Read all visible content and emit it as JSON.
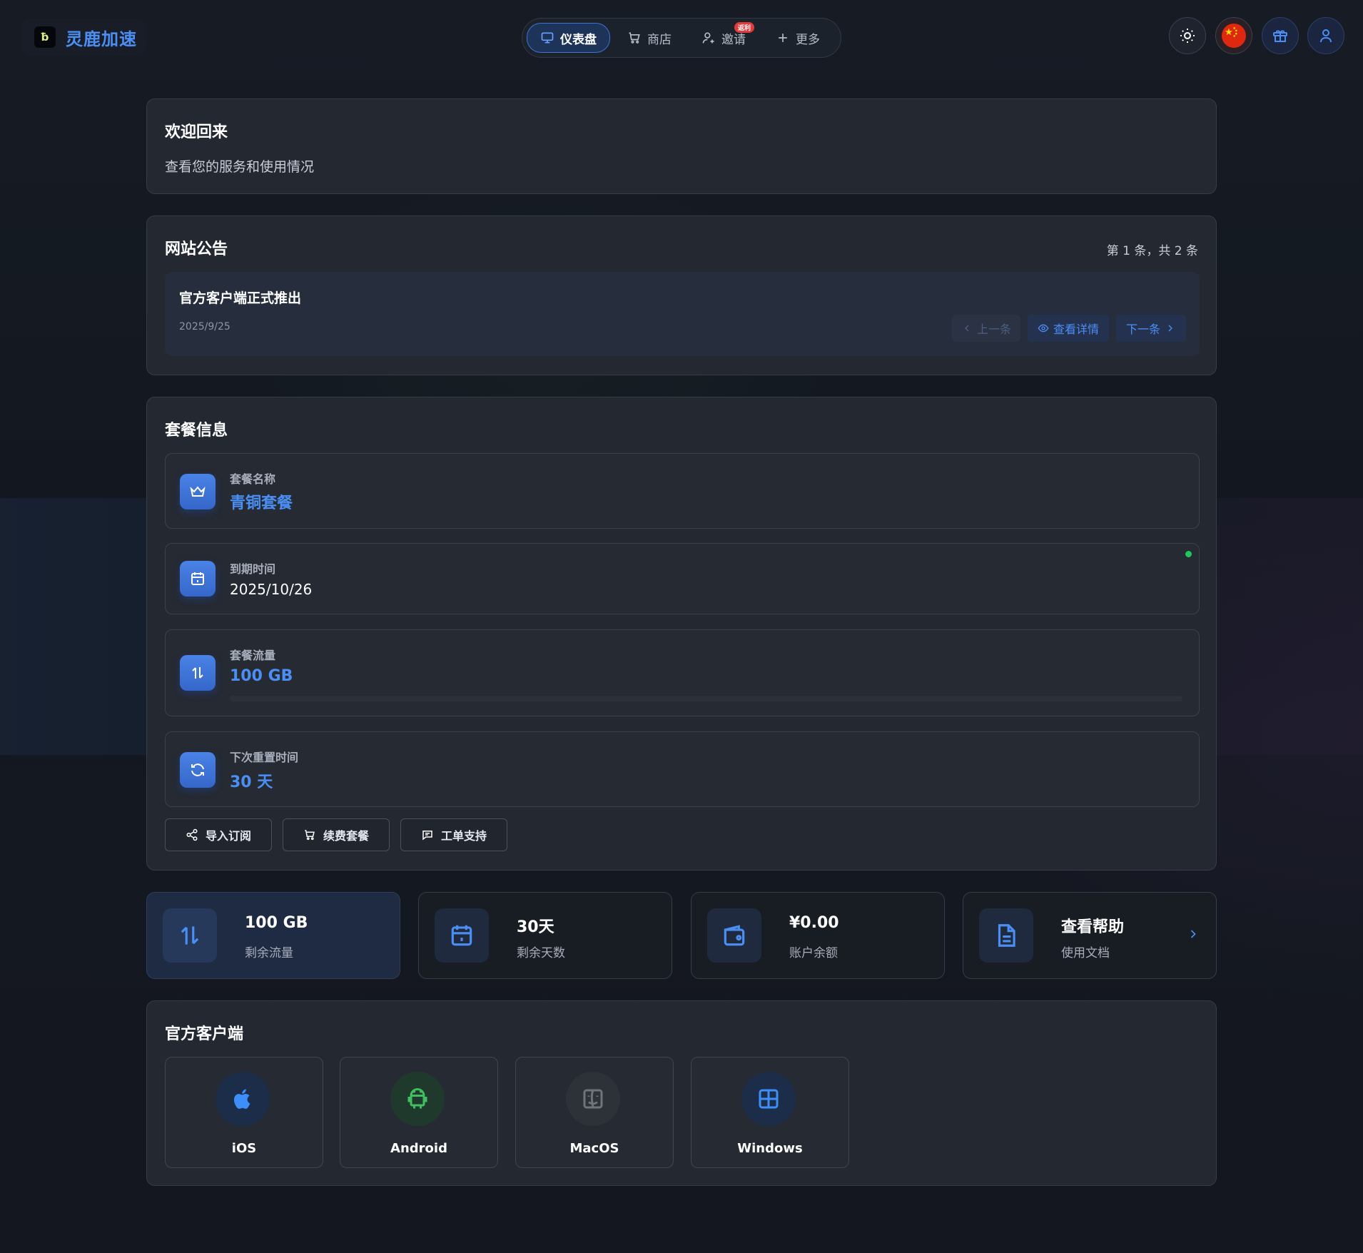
{
  "brand": {
    "name": "灵鹿加速",
    "mark": "ƀ"
  },
  "nav": {
    "items": [
      {
        "label": "仪表盘",
        "icon": "monitor-icon",
        "active": true
      },
      {
        "label": "商店",
        "icon": "cart-icon"
      },
      {
        "label": "邀请",
        "icon": "user-plus-icon",
        "badge": "返利"
      },
      {
        "label": "更多",
        "icon": "plus-icon"
      }
    ]
  },
  "header_actions": [
    "sun-icon",
    "china-flag-icon",
    "gift-icon",
    "user-icon"
  ],
  "welcome": {
    "title": "欢迎回来",
    "subtitle": "查看您的服务和使用情况"
  },
  "announcements": {
    "title": "网站公告",
    "pager": "第 1 条，共 2 条",
    "item": {
      "title": "官方客户端正式推出",
      "date": "2025/9/25"
    },
    "prev_label": "上一条",
    "detail_label": "查看详情",
    "next_label": "下一条"
  },
  "plan": {
    "title": "套餐信息",
    "name_label": "套餐名称",
    "name_value": "青铜套餐",
    "expire_label": "到期时间",
    "expire_value": "2025/10/26",
    "traffic_label": "套餐流量",
    "traffic_value": "100 GB",
    "traffic_used_fraction": 0.0,
    "reset_label": "下次重置时间",
    "reset_value": "30 天",
    "status_color": "#22c55e",
    "actions": {
      "import": "导入订阅",
      "renew": "续费套餐",
      "ticket": "工单支持"
    }
  },
  "stats": [
    {
      "value": "100 GB",
      "label": "剩余流量",
      "icon": "traffic-icon"
    },
    {
      "value": "30天",
      "label": "剩余天数",
      "icon": "calendar-icon"
    },
    {
      "value": "¥0.00",
      "label": "账户余额",
      "icon": "wallet-icon"
    },
    {
      "value": "查看帮助",
      "label": "使用文档",
      "icon": "document-icon"
    }
  ],
  "clients": {
    "title": "官方客户端",
    "items": [
      {
        "name": "iOS",
        "icon": "apple-icon"
      },
      {
        "name": "Android",
        "icon": "android-icon"
      },
      {
        "name": "MacOS",
        "icon": "finder-icon"
      },
      {
        "name": "Windows",
        "icon": "windows-icon"
      }
    ]
  },
  "colors": {
    "accent": "#4b8ff5",
    "background": "#121720",
    "card": "#232831",
    "android": "#3fbf5f"
  }
}
